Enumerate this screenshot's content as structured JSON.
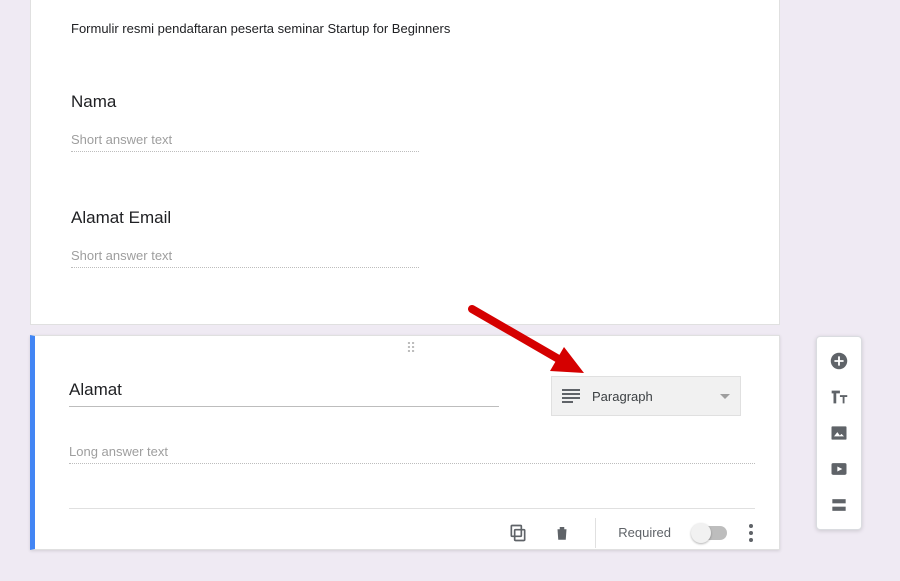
{
  "form": {
    "description": "Formulir resmi pendaftaran peserta seminar Startup for Beginners"
  },
  "questions": [
    {
      "title": "Nama",
      "placeholder": "Short answer text"
    },
    {
      "title": "Alamat Email",
      "placeholder": "Short answer text"
    }
  ],
  "active_question": {
    "title": "Alamat",
    "placeholder": "Long answer text",
    "type_label": "Paragraph",
    "required_label": "Required"
  },
  "side_toolbar": {
    "add": "add-question",
    "title": "add-title",
    "image": "add-image",
    "video": "add-video",
    "section": "add-section"
  }
}
